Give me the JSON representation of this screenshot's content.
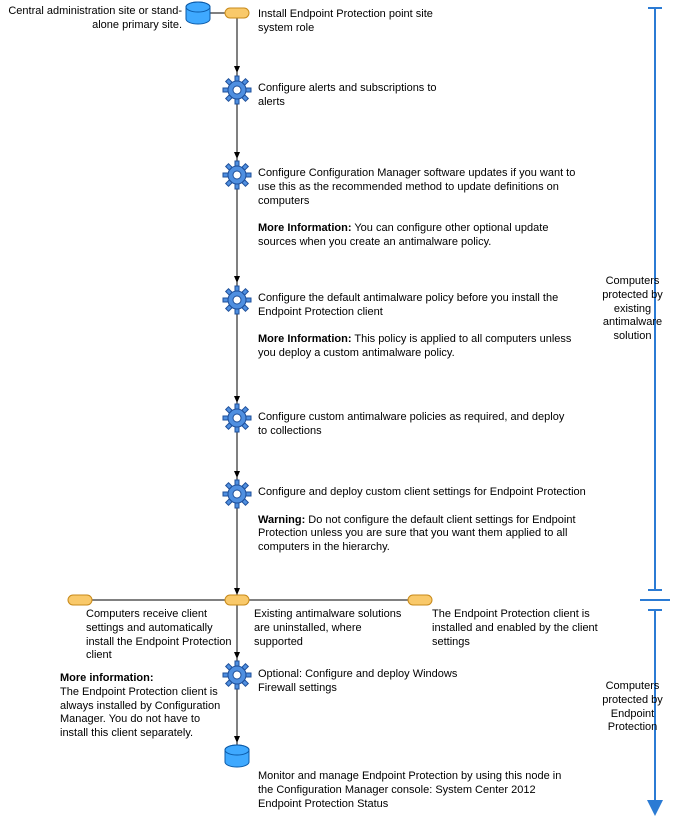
{
  "topLabel": "Central administration site or stand-alone primary site.",
  "steps": {
    "s1": "Install Endpoint Protection point site system role",
    "s2": "Configure alerts and subscriptions to alerts",
    "s3a": "Configure Configuration Manager software updates if you want to use this as the recommended method to update definitions on computers",
    "s3bLabel": "More Information:",
    "s3bText": " You can configure other optional update sources when you create an antimalware policy.",
    "s4a": "Configure the default antimalware policy before you install the Endpoint Protection client",
    "s4bLabel": "More Information:",
    "s4bText": " This policy is applied to all computers unless you deploy a custom antimalware policy.",
    "s5": "Configure custom antimalware policies as required, and deploy to collections",
    "s6a": "Configure and deploy custom client settings for Endpoint Protection",
    "s6bLabel": "Warning:",
    "s6bText": " Do not configure the default client settings for Endpoint Protection unless you are sure that you want them applied to all computers in the hierarchy."
  },
  "branches": {
    "left": "Computers receive client settings and automatically install the Endpoint Protection client",
    "mid": "Existing antimalware solutions are uninstalled, where supported",
    "right": "The Endpoint Protection client is installed and enabled by the client settings"
  },
  "moreInfo": {
    "label": "More information:",
    "text": "The Endpoint Protection client is always installed by Configuration Manager. You do not have to install this client separately."
  },
  "tail": {
    "t1": "Optional: Configure and deploy Windows Firewall settings",
    "t2": "Monitor and manage Endpoint Protection by using this node in the Configuration Manager console: System Center 2012 Endpoint Protection Status"
  },
  "sideLabels": {
    "top": "Computers protected by existing antimalware solution",
    "bottom": "Computers protected by Endpoint Protection"
  }
}
